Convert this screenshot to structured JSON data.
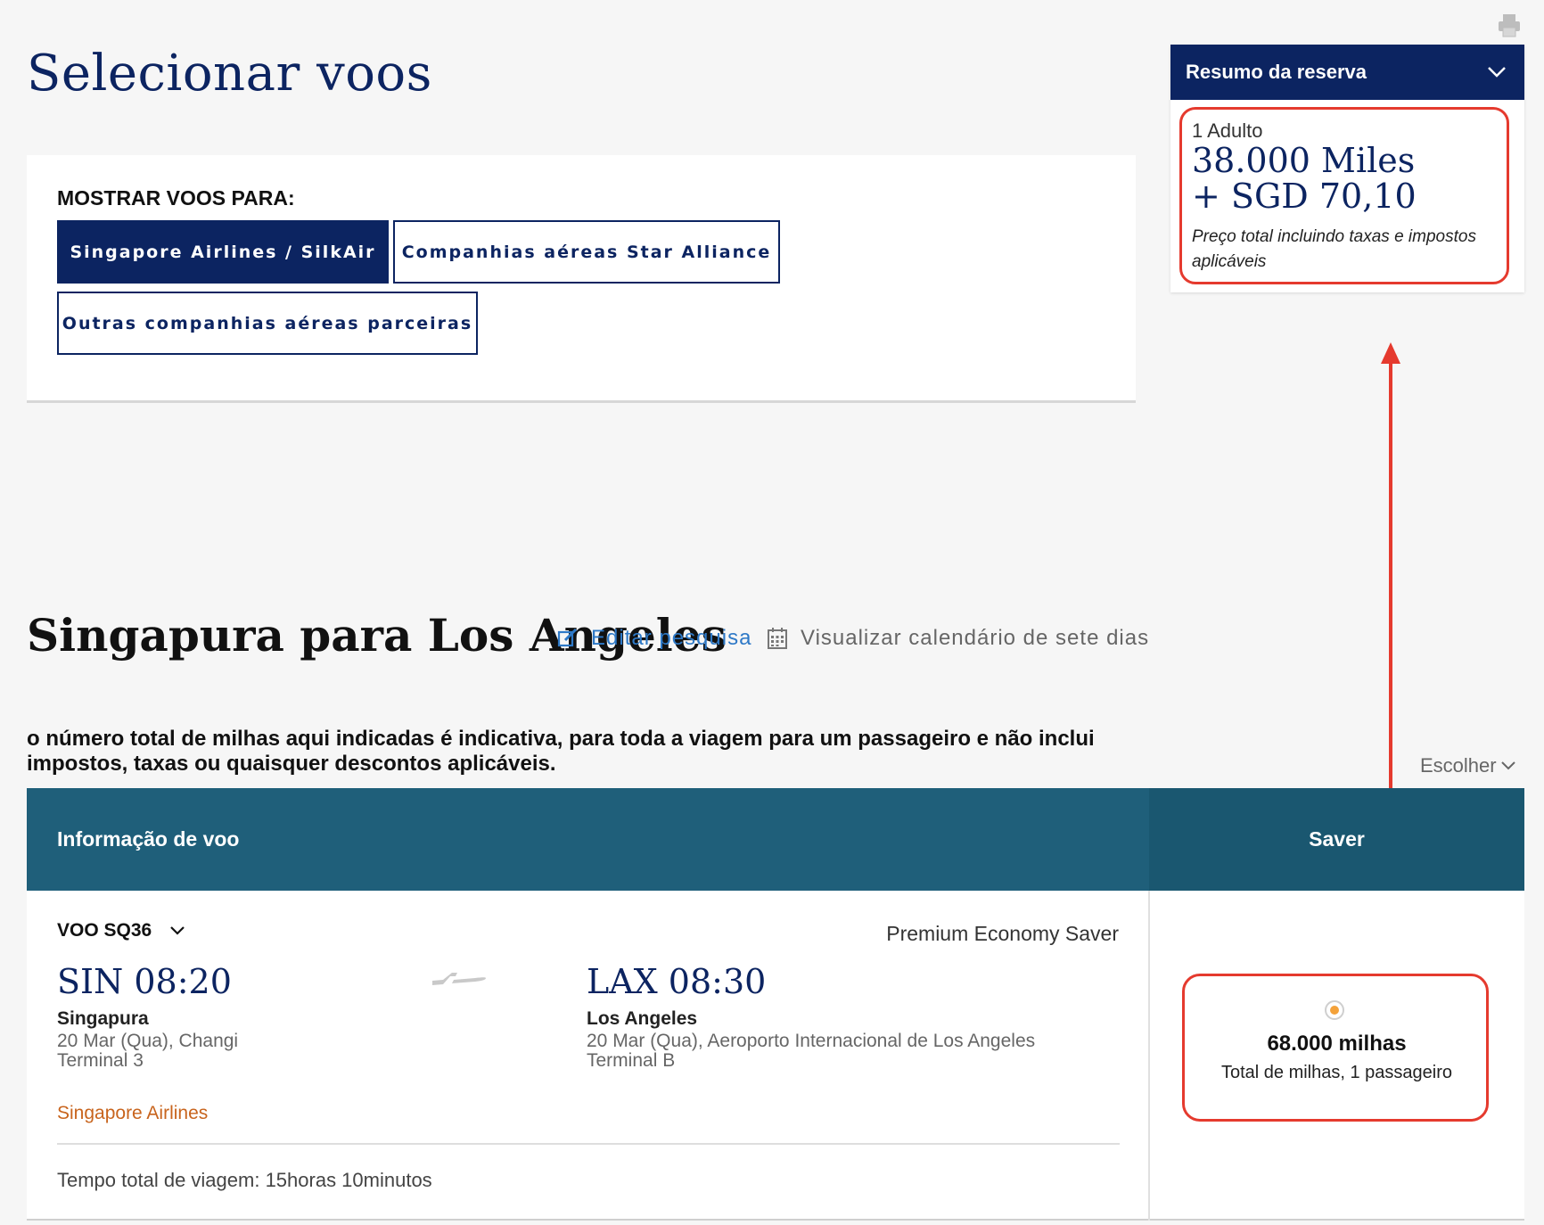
{
  "page": {
    "title": "Selecionar voos"
  },
  "filters": {
    "heading": "MOSTRAR VOOS PARA:",
    "options": [
      {
        "label": "Singapore Airlines / SilkAir",
        "selected": true
      },
      {
        "label": "Companhias aéreas Star Alliance",
        "selected": false
      },
      {
        "label": "Outras companhias aéreas parceiras",
        "selected": false
      }
    ]
  },
  "summary": {
    "title": "Resumo da reserva",
    "passengers": "1 Adulto",
    "miles": "38.000 Miles",
    "cash": "+ SGD 70,10",
    "note": "Preço total incluindo taxas e impostos aplicáveis"
  },
  "route": {
    "title": "Singapura para Los Angeles",
    "edit_label": "Editar pesquisa",
    "calendar_label": "Visualizar calendário de sete dias"
  },
  "disclaimer": "o número total de milhas aqui indicadas é indicativa, para toda a viagem para um passageiro e não inclui impostos, taxas ou quaisquer descontos aplicáveis.",
  "sort_label": "Escolher",
  "table": {
    "col_flight_info": "Informação de voo",
    "col_fare": "Saver"
  },
  "flight": {
    "number": "VOO SQ36",
    "cabin": "Premium Economy Saver",
    "departure": {
      "time": "SIN 08:20",
      "city": "Singapura",
      "date_airport": "20 Mar (Qua), Changi",
      "terminal": "Terminal 3"
    },
    "arrival": {
      "time": "LAX 08:30",
      "city": "Los Angeles",
      "date_airport": "20 Mar (Qua), Aeroporto Internacional de Los Angeles",
      "terminal": "Terminal B"
    },
    "carrier": "Singapore Airlines",
    "duration": "Tempo total de viagem: 15horas 10minutos",
    "fare": {
      "miles": "68.000 milhas",
      "sub": "Total de milhas, 1 passageiro",
      "selected": true
    }
  },
  "colors": {
    "navy": "#0c2461",
    "teal_header": "#1f5f7a",
    "highlight": "#e53a2e",
    "carrier": "#c8641d",
    "link": "#2e79c7",
    "radio": "#f4a23a"
  },
  "icons": [
    "print-icon",
    "chevron-down-icon",
    "edit-icon",
    "calendar-icon",
    "plane-icon",
    "radio-icon"
  ]
}
